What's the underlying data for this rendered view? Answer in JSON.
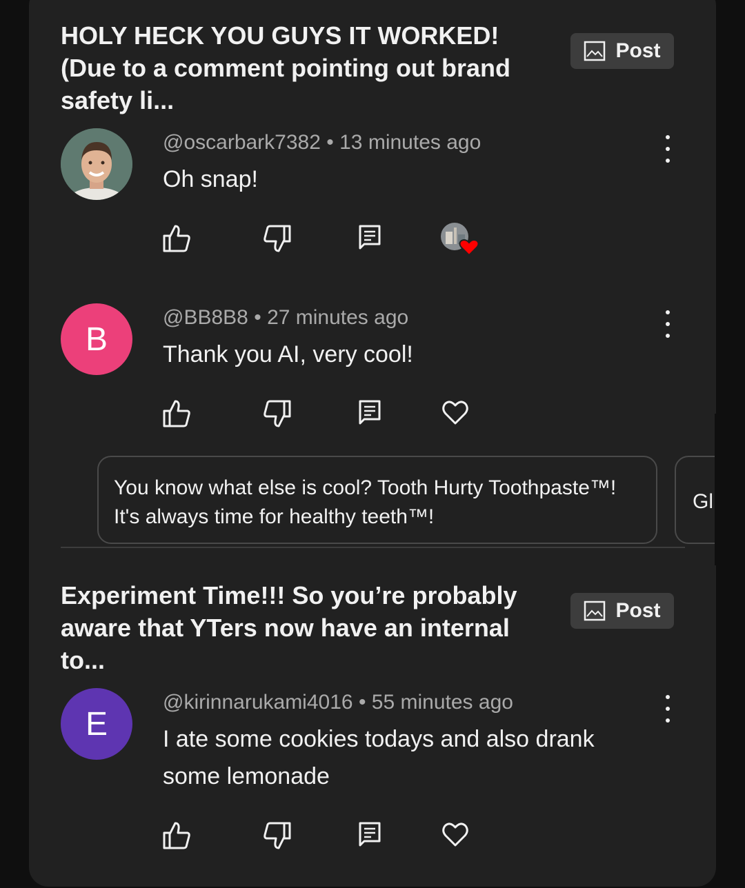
{
  "sections": [
    {
      "title": "HOLY HECK YOU GUYS IT WORKED! (Due to a comment pointing out brand safety li...",
      "post_label": "Post",
      "comments": [
        {
          "handle": "@oscarbark7382",
          "time": "13 minutes ago",
          "text": "Oh snap!",
          "avatar": "photo",
          "hearted": true
        },
        {
          "handle": "@BB8B8",
          "time": "27 minutes ago",
          "text": "Thank you AI, very cool!",
          "avatar_letter": "B",
          "avatar_color": "#ec407a",
          "hearted": false,
          "replies": [
            "You know what else is cool? Tooth Hurty Toothpaste™! It's always time for healthy teeth™!",
            "Gl"
          ]
        }
      ]
    },
    {
      "title": "Experiment Time!!! So you’re probably aware that YTers now have an internal to...",
      "post_label": "Post",
      "comments": [
        {
          "handle": "@kirinnarukami4016",
          "time": "55 minutes ago",
          "text": "I ate some cookies todays and also drank some lemonade",
          "avatar_letter": "E",
          "avatar_color": "#5e35b1",
          "hearted": false
        }
      ]
    }
  ],
  "meta_separator": "•",
  "icons": [
    "image-icon",
    "like-icon",
    "dislike-icon",
    "reply-icon",
    "heart-icon",
    "more-vert-icon"
  ],
  "colors": {
    "background": "#0f0f0f",
    "card": "#212121",
    "chip": "#3d3d3d",
    "heart_red": "#ff0000"
  }
}
